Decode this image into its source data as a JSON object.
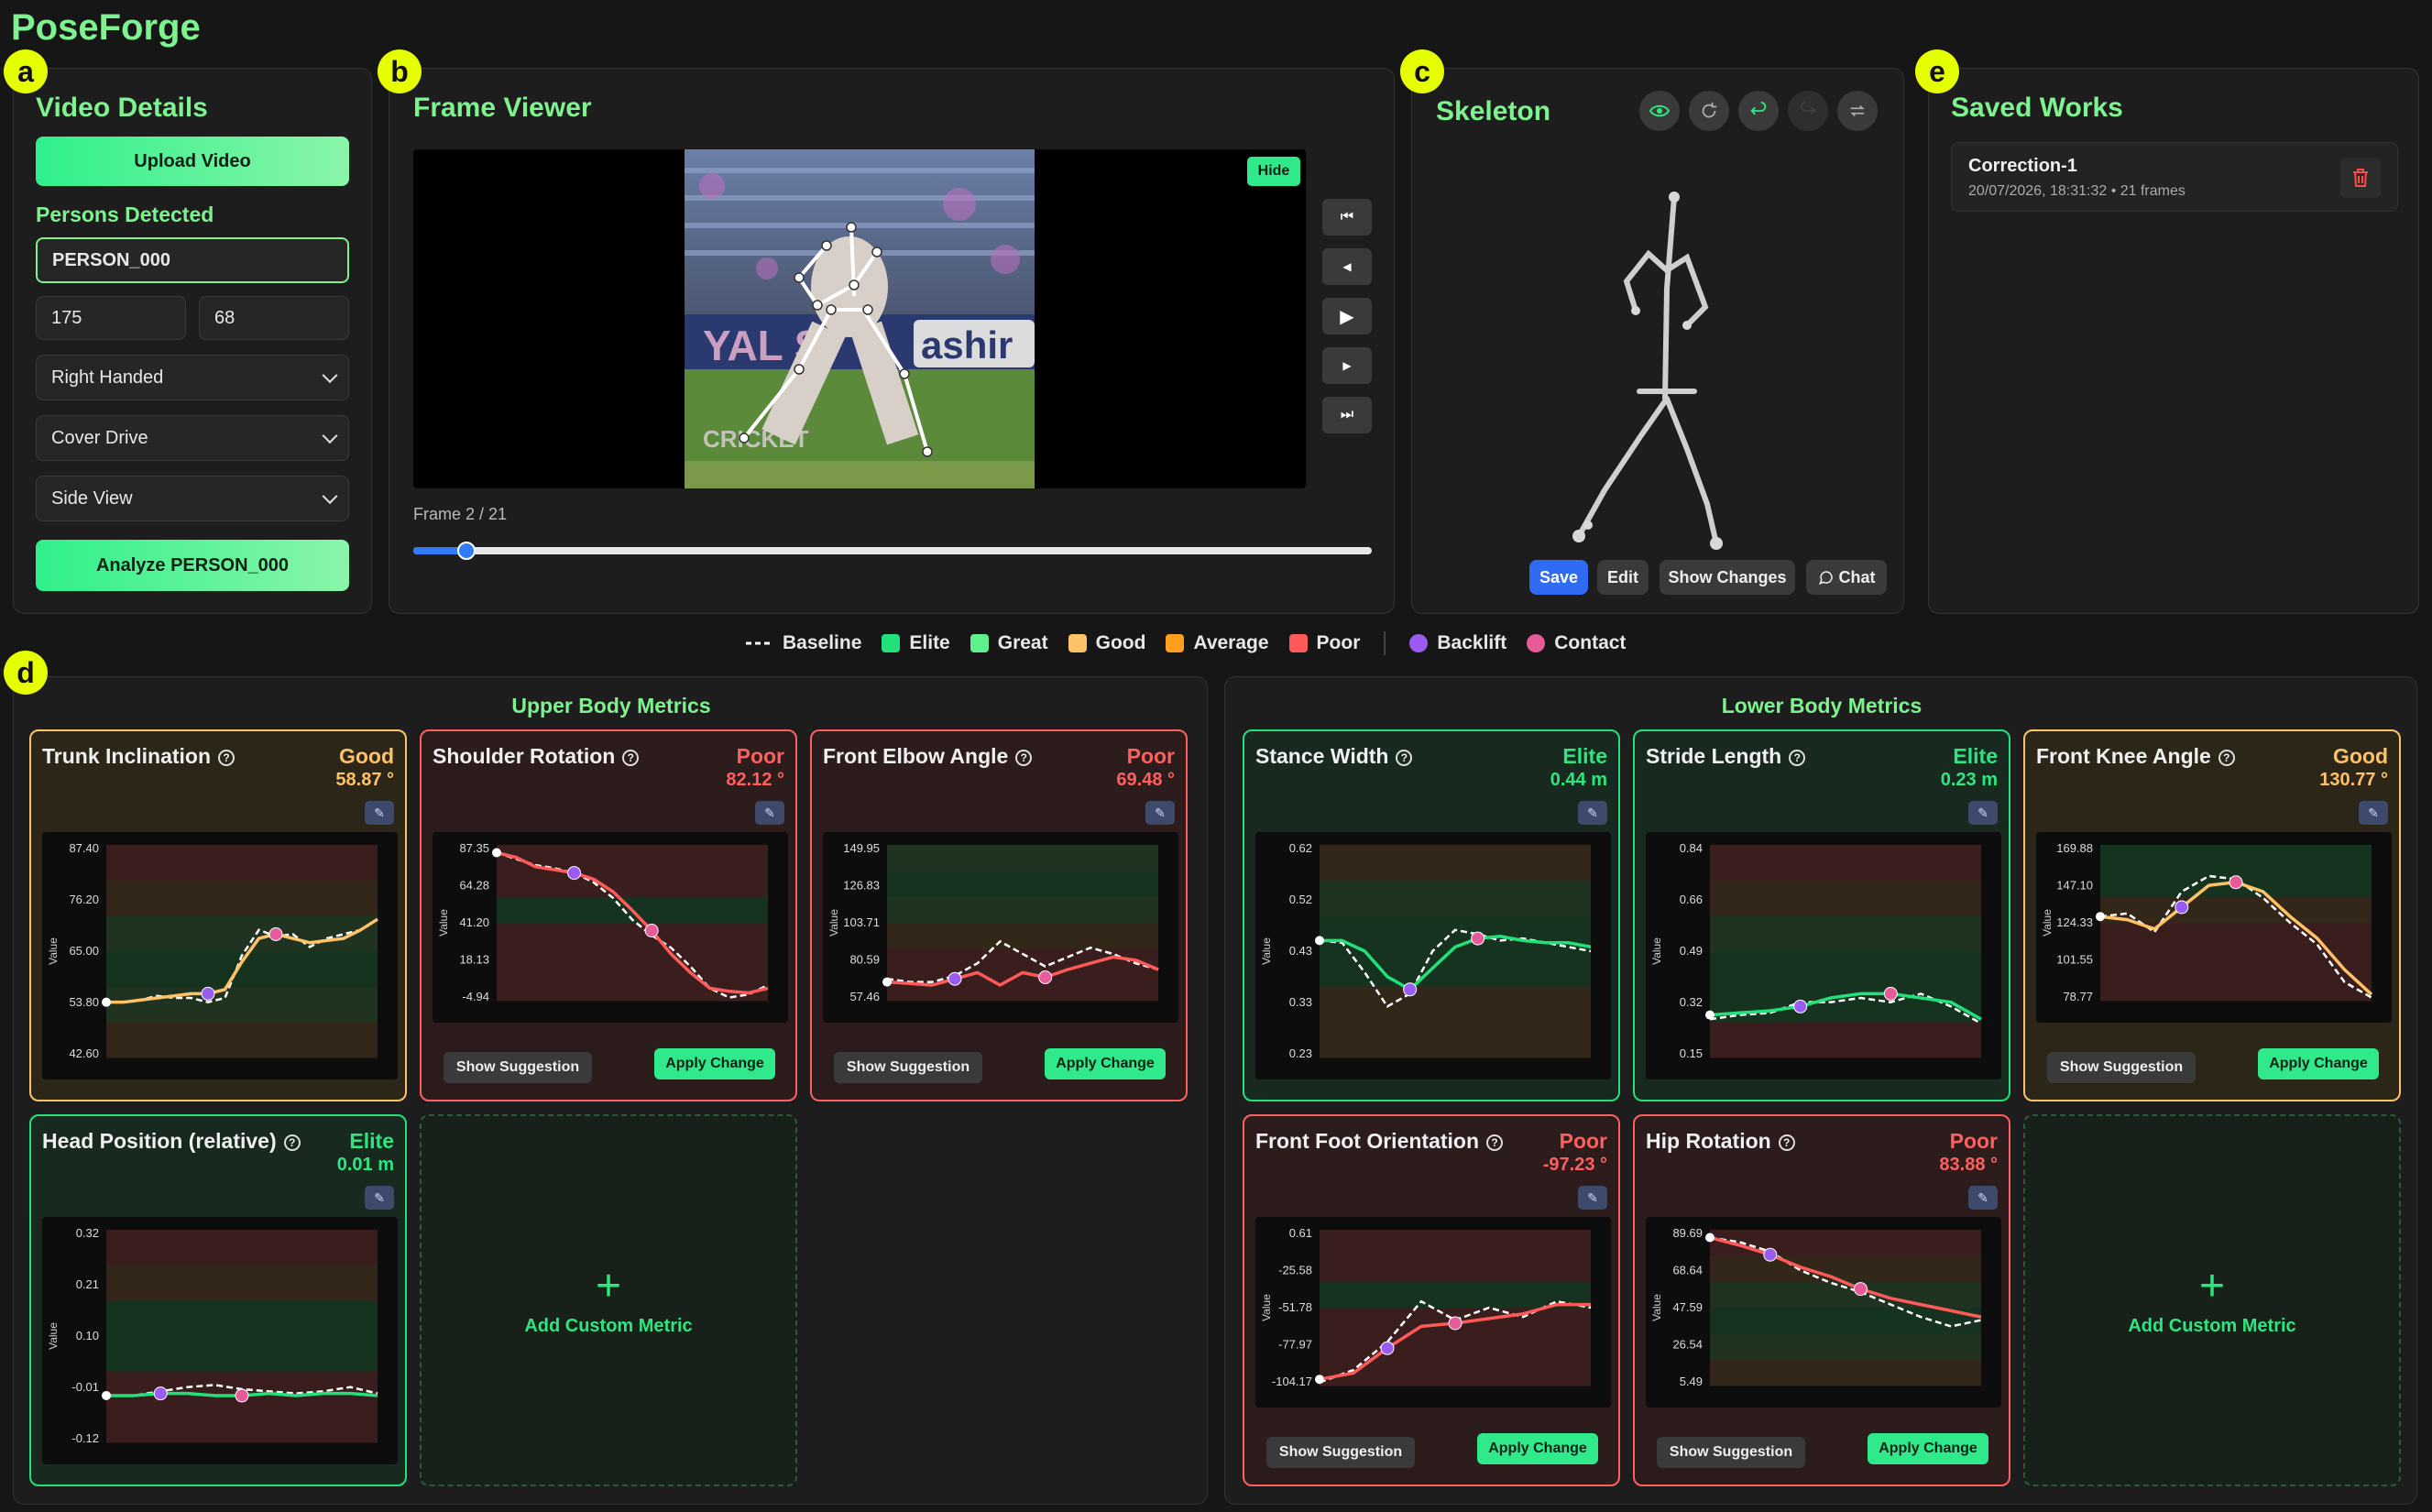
{
  "app": {
    "title": "PoseForge"
  },
  "badges": {
    "a": "a",
    "b": "b",
    "c": "c",
    "d": "d",
    "e": "e"
  },
  "video_details": {
    "title": "Video Details",
    "upload_label": "Upload Video",
    "persons_label": "Persons Detected",
    "person_value": "PERSON_000",
    "height_value": "175",
    "weight_value": "68",
    "handedness": "Right Handed",
    "shot_type": "Cover Drive",
    "view": "Side View",
    "analyze_label": "Analyze PERSON_000"
  },
  "frame_viewer": {
    "title": "Frame Viewer",
    "hide_label": "Hide",
    "frame_text": "Frame 2 / 21",
    "frame_current": 2,
    "frame_total": 21,
    "controls": [
      "first-frame-icon",
      "prev-frame-icon",
      "play-icon",
      "next-frame-icon",
      "last-frame-icon"
    ],
    "overlay_text_1": "YAL S",
    "overlay_text_2": "ashir",
    "overlay_text_3": "CRICKET"
  },
  "skeleton": {
    "title": "Skeleton",
    "icons": [
      "eye-icon",
      "refresh-icon",
      "undo-icon",
      "redo-icon",
      "swap-icon"
    ],
    "save_label": "Save",
    "edit_label": "Edit",
    "show_changes_label": "Show Changes",
    "chat_label": "Chat"
  },
  "saved_works": {
    "title": "Saved Works",
    "items": [
      {
        "name": "Correction-1",
        "meta": "20/07/2026, 18:31:32 • 21 frames"
      }
    ]
  },
  "legend": {
    "baseline": "Baseline",
    "elite": "Elite",
    "great": "Great",
    "good": "Good",
    "average": "Average",
    "poor": "Poor",
    "backlift": "Backlift",
    "contact": "Contact",
    "colors": {
      "elite": "#22e07a",
      "great": "#5ef08c",
      "good": "#ffc266",
      "average": "#ff9d1f",
      "poor": "#ff5a5a",
      "backlift": "#9a5cf0",
      "contact": "#e85a9a"
    }
  },
  "upper_body": {
    "title": "Upper Body Metrics",
    "metrics": [
      {
        "name": "Trunk Inclination",
        "status": "Good",
        "value": "58.87 °",
        "ticks": [
          "87.40",
          "76.20",
          "65.00",
          "53.80",
          "42.60"
        ]
      },
      {
        "name": "Shoulder Rotation",
        "status": "Poor",
        "value": "82.12 °",
        "ticks": [
          "87.35",
          "64.28",
          "41.20",
          "18.13",
          "-4.94"
        ]
      },
      {
        "name": "Front Elbow Angle",
        "status": "Poor",
        "value": "69.48 °",
        "ticks": [
          "149.95",
          "126.83",
          "103.71",
          "80.59",
          "57.46"
        ]
      },
      {
        "name": "Head Position (relative)",
        "status": "Elite",
        "value": "0.01 m",
        "ticks": [
          "0.32",
          "0.21",
          "0.10",
          "-0.01",
          "-0.12"
        ]
      }
    ],
    "add_label": "Add Custom Metric"
  },
  "lower_body": {
    "title": "Lower Body Metrics",
    "metrics": [
      {
        "name": "Stance Width",
        "status": "Elite",
        "value": "0.44 m",
        "ticks": [
          "0.62",
          "0.52",
          "0.43",
          "0.33",
          "0.23"
        ]
      },
      {
        "name": "Stride Length",
        "status": "Elite",
        "value": "0.23 m",
        "ticks": [
          "0.84",
          "0.66",
          "0.49",
          "0.32",
          "0.15"
        ]
      },
      {
        "name": "Front Knee Angle",
        "status": "Good",
        "value": "130.77 °",
        "ticks": [
          "169.88",
          "147.10",
          "124.33",
          "101.55",
          "78.77"
        ]
      },
      {
        "name": "Front Foot Orientation",
        "status": "Poor",
        "value": "-97.23 °",
        "ticks": [
          "0.61",
          "-25.58",
          "-51.78",
          "-77.97",
          "-104.17"
        ]
      },
      {
        "name": "Hip Rotation",
        "status": "Poor",
        "value": "83.88 °",
        "ticks": [
          "89.69",
          "68.64",
          "47.59",
          "26.54",
          "5.49"
        ]
      }
    ],
    "add_label": "Add Custom Metric"
  },
  "common": {
    "y_axis_label": "Value",
    "show_suggestion": "Show Suggestion",
    "apply_change": "Apply Change"
  }
}
